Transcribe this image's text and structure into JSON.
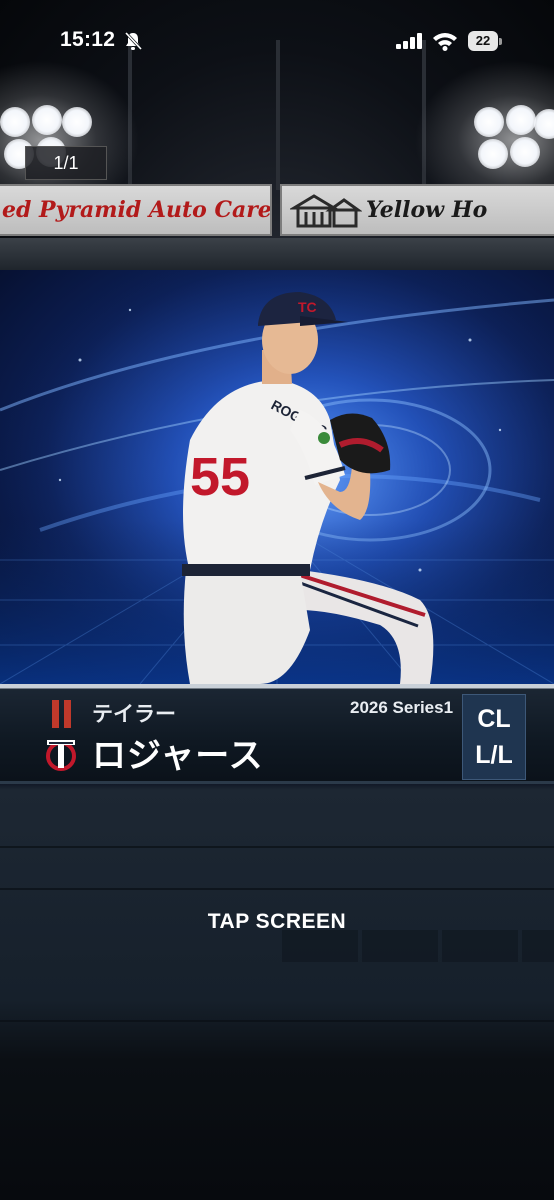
{
  "status_bar": {
    "time": "15:12",
    "battery": "22",
    "icons": [
      "bell-off-icon",
      "signal-icon",
      "wifi-icon",
      "battery-icon"
    ]
  },
  "viewer": {
    "counter": "1/1"
  },
  "billboards": {
    "left_text": "ed Pyramid Auto Care",
    "right_text": "Yellow Ho"
  },
  "player": {
    "first_name": "テイラー",
    "last_name": "ロジャース",
    "series": "2026 Series1",
    "rank": "CL",
    "handedness": "L/L",
    "jersey_number": "55",
    "jersey_name": "ROGERS",
    "team_logo": "twins-tc-logo"
  },
  "prompt": {
    "tap_label": "TAP SCREEN"
  },
  "colors": {
    "accent_red": "#c0392b",
    "panel_blue": "#1f3550",
    "card_blue": "#2d6bd8"
  }
}
